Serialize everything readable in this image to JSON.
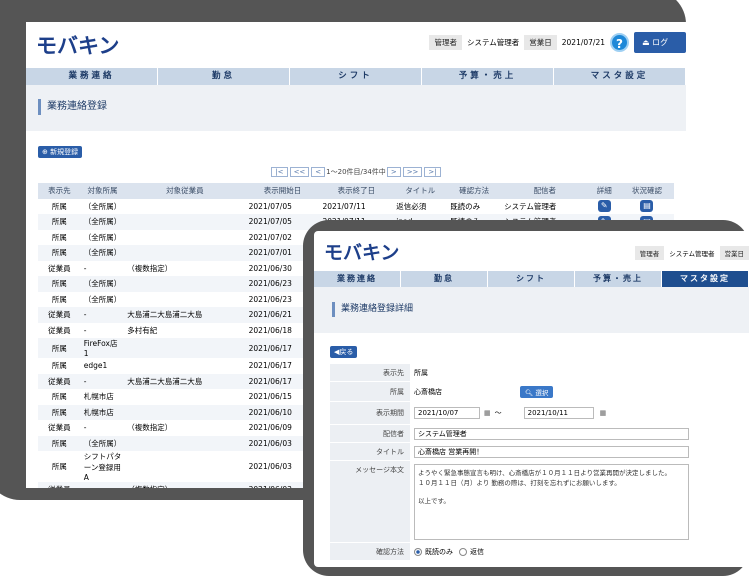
{
  "back_screen": {
    "logo": "モバキン",
    "header": {
      "role_label": "管理者",
      "user_name": "システム管理者",
      "bizday_label": "営業日",
      "bizday": "2021/07/21",
      "help_icon": "?",
      "logout_label": "ログ"
    },
    "nav": [
      "業務連絡",
      "勤怠",
      "シフト",
      "予算・売上",
      "マスタ設定"
    ],
    "page_title": "業務連絡登録",
    "new_button": "新規登録",
    "pager": {
      "first": "|<",
      "prev_many": "<<",
      "prev": "<",
      "info": "1～20件目/34件中",
      "next": ">",
      "next_many": ">>",
      "last": ">|"
    },
    "columns": [
      "表示先",
      "対象所属",
      "対象従業員",
      "表示開始日",
      "表示終了日",
      "タイトル",
      "確認方法",
      "配信者",
      "詳細",
      "状況確認"
    ],
    "rows": [
      {
        "target": "所属",
        "dept": "（全所属）",
        "emp": "",
        "start": "2021/07/05",
        "end": "2021/07/11",
        "title": "返信必須",
        "method": "既読のみ",
        "sender": "システム管理者",
        "icons": true
      },
      {
        "target": "所属",
        "dept": "（全所属）",
        "emp": "",
        "start": "2021/07/05",
        "end": "2021/07/11",
        "title": "ipad",
        "method": "既読のみ",
        "sender": "システム管理者",
        "icons": true
      },
      {
        "target": "所属",
        "dept": "（全所属）",
        "emp": "",
        "start": "2021/07/02",
        "end": "2021/07/0",
        "title": "",
        "method": "",
        "sender": "",
        "icons": true
      },
      {
        "target": "所属",
        "dept": "（全所属）",
        "emp": "",
        "start": "2021/07/01",
        "end": "",
        "title": "",
        "method": "",
        "sender": "",
        "icons": false
      },
      {
        "target": "従業員",
        "dept": "-",
        "emp": "（複数指定）",
        "start": "2021/06/30",
        "end": "",
        "title": "",
        "method": "",
        "sender": "",
        "icons": false
      },
      {
        "target": "所属",
        "dept": "（全所属）",
        "emp": "",
        "start": "2021/06/23",
        "end": "",
        "title": "",
        "method": "",
        "sender": "",
        "icons": false
      },
      {
        "target": "所属",
        "dept": "（全所属）",
        "emp": "",
        "start": "2021/06/23",
        "end": "",
        "title": "",
        "method": "",
        "sender": "",
        "icons": false
      },
      {
        "target": "従業員",
        "dept": "-",
        "emp": "大島浦二大島浦二大島",
        "start": "2021/06/21",
        "end": "",
        "title": "",
        "method": "",
        "sender": "",
        "icons": false
      },
      {
        "target": "従業員",
        "dept": "-",
        "emp": "多村有紀",
        "start": "2021/06/18",
        "end": "",
        "title": "",
        "method": "",
        "sender": "",
        "icons": false
      },
      {
        "target": "所属",
        "dept": "FireFox店1",
        "emp": "",
        "start": "2021/06/17",
        "end": "",
        "title": "",
        "method": "",
        "sender": "",
        "icons": false
      },
      {
        "target": "所属",
        "dept": "edge1",
        "emp": "",
        "start": "2021/06/17",
        "end": "",
        "title": "",
        "method": "",
        "sender": "",
        "icons": false
      },
      {
        "target": "従業員",
        "dept": "-",
        "emp": "大島浦二大島浦二大島",
        "start": "2021/06/17",
        "end": "",
        "title": "",
        "method": "",
        "sender": "",
        "icons": false
      },
      {
        "target": "所属",
        "dept": "札幌市店",
        "emp": "",
        "start": "2021/06/15",
        "end": "",
        "title": "",
        "method": "",
        "sender": "",
        "icons": false
      },
      {
        "target": "所属",
        "dept": "札幌市店",
        "emp": "",
        "start": "2021/06/10",
        "end": "",
        "title": "",
        "method": "",
        "sender": "",
        "icons": false
      },
      {
        "target": "従業員",
        "dept": "-",
        "emp": "（複数指定）",
        "start": "2021/06/09",
        "end": "",
        "title": "",
        "method": "",
        "sender": "",
        "icons": false
      },
      {
        "target": "所属",
        "dept": "（全所属）",
        "emp": "",
        "start": "2021/06/03",
        "end": "",
        "title": "",
        "method": "",
        "sender": "",
        "icons": false
      },
      {
        "target": "所属",
        "dept": "シフトパターン登録用A",
        "emp": "",
        "start": "2021/06/03",
        "end": "",
        "title": "",
        "method": "",
        "sender": "",
        "icons": false
      },
      {
        "target": "従業員",
        "dept": "-",
        "emp": "（複数指定）",
        "start": "2021/06/03",
        "end": "",
        "title": "",
        "method": "",
        "sender": "",
        "icons": false
      }
    ]
  },
  "front_screen": {
    "logo": "モバキン",
    "header": {
      "role_label": "管理者",
      "user_name": "システム管理者",
      "bizday_label": "営業日"
    },
    "nav": [
      "業務連絡",
      "勤怠",
      "シフト",
      "予算・売上",
      "マスタ設定"
    ],
    "page_title": "業務連絡登録詳細",
    "back_button": "戻る",
    "form": {
      "target_label": "表示先",
      "target_value": "所属",
      "dept_label": "所属",
      "dept_value": "心斎橋店",
      "select_button": "選択",
      "period_label": "表示期間",
      "period_start": "2021/10/07",
      "period_sep": "～",
      "period_end": "2021/10/11",
      "sender_label": "配信者",
      "sender_value": "システム管理者",
      "title_label": "タイトル",
      "title_value": "心斎橋店 営業再開！",
      "body_label": "メッセージ本文",
      "body_lines": [
        "ようやく緊急事態宣言も明け、心斎橋店が１０月１１日より営業再開が決定しました。",
        "１０月１１日（月）より 勤務の際は、打刻を忘れずにお願いします。",
        "以上です。"
      ],
      "method_label": "確認方法",
      "method_opt1": "既読のみ",
      "method_opt2": "返信"
    }
  }
}
